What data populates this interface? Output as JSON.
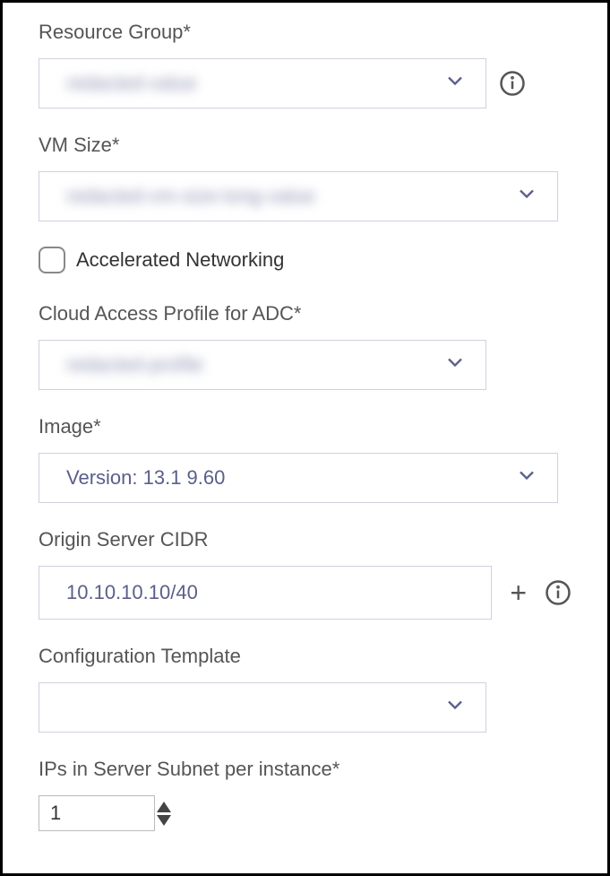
{
  "resource_group": {
    "label": "Resource Group*",
    "value": "redacted-value"
  },
  "vm_size": {
    "label": "VM Size*",
    "value": "redacted-vm-size-long-value"
  },
  "accelerated_networking": {
    "label": "Accelerated Networking"
  },
  "cloud_access_profile": {
    "label": "Cloud Access Profile for ADC*",
    "value": "redacted-profile"
  },
  "image": {
    "label": "Image*",
    "value": "Version: 13.1 9.60"
  },
  "origin_cidr": {
    "label": "Origin Server CIDR",
    "value": "10.10.10.10/40"
  },
  "config_template": {
    "label": "Configuration Template",
    "value": ""
  },
  "ips_per_instance": {
    "label": "IPs in Server Subnet per instance*",
    "value": "1"
  }
}
